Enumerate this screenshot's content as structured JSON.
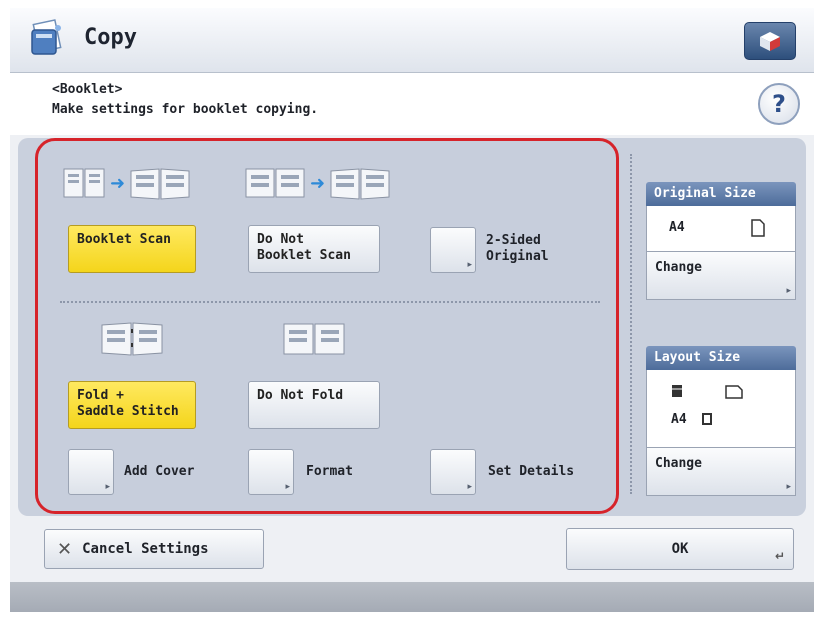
{
  "window": {
    "title": "Copy"
  },
  "header": {
    "subtitle": "<Booklet>",
    "description": "Make settings for booklet copying.",
    "help_label": "?"
  },
  "scan_options": {
    "booklet_scan": "Booklet Scan",
    "do_not_booklet_scan_line1": "Do Not",
    "do_not_booklet_scan_line2": "Booklet Scan",
    "two_sided_original_line1": "2-Sided",
    "two_sided_original_line2": "Original"
  },
  "fold_options": {
    "fold_saddle_line1": "Fold +",
    "fold_saddle_line2": "Saddle Stitch",
    "do_not_fold": "Do Not Fold"
  },
  "more_options": {
    "add_cover": "Add Cover",
    "format": "Format",
    "set_details": "Set Details"
  },
  "original_size": {
    "header": "Original Size",
    "value": "A4",
    "change_label": "Change"
  },
  "layout_size": {
    "header": "Layout Size",
    "value": "A4",
    "change_label": "Change"
  },
  "footer": {
    "cancel_label": "Cancel Settings",
    "ok_label": "OK"
  },
  "colors": {
    "selected": "#f4d51b",
    "highlight_border": "#d6232a",
    "info_header": "#5a78a5",
    "arrow": "#2e8ad8"
  }
}
